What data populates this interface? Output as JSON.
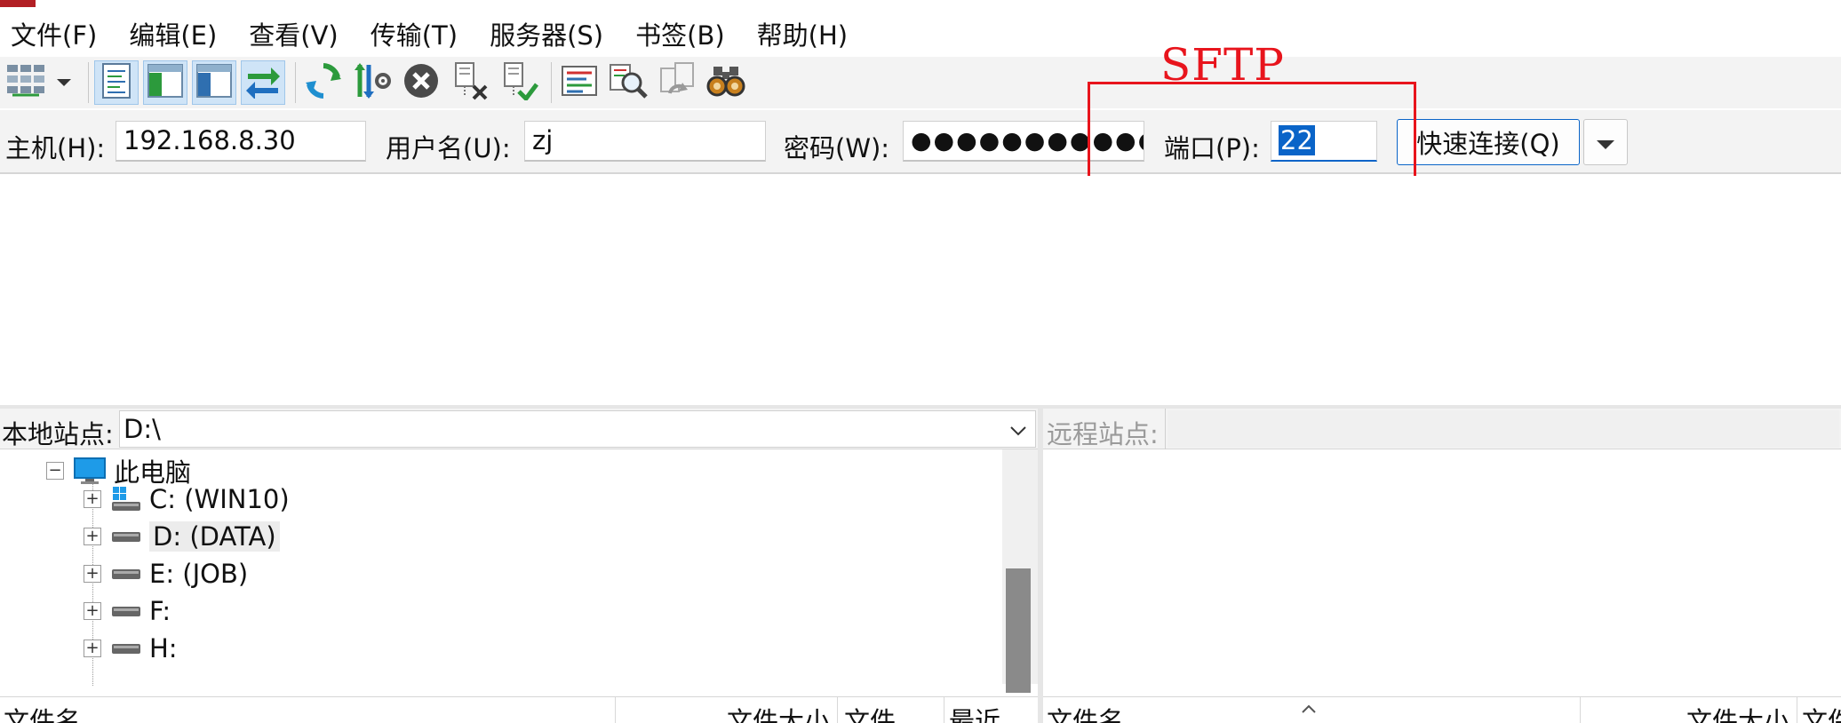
{
  "menu": {
    "items": [
      "文件(F)",
      "编辑(E)",
      "查看(V)",
      "传输(T)",
      "服务器(S)",
      "书签(B)",
      "帮助(H)"
    ]
  },
  "toolbar": {
    "icons": [
      "site-manager-icon",
      "dropdown-arrow-icon",
      "message-log-toggle-icon",
      "local-tree-toggle-icon",
      "remote-tree-toggle-icon",
      "transfer-queue-toggle-icon",
      "refresh-icon",
      "process-queue-icon",
      "cancel-icon",
      "disconnect-icon",
      "reconnect-icon",
      "directory-filter-icon",
      "directory-compare-icon",
      "sync-browse-icon",
      "search-files-icon"
    ]
  },
  "quickconnect": {
    "host_label": "主机(H):",
    "host_value": "192.168.8.30",
    "user_label": "用户名(U):",
    "user_value": "zj",
    "pass_label": "密码(W):",
    "pass_value": "●●●●●●●●●●●",
    "port_label": "端口(P):",
    "port_value": "22",
    "connect_label": "快速连接(Q)"
  },
  "annotation": {
    "text": "SFTP",
    "color": "#e8141c"
  },
  "local": {
    "site_label": "本地站点:",
    "site_path": "D:\\",
    "tree": [
      {
        "label": "此电脑",
        "expander": "−"
      },
      {
        "label": "C: (WIN10)",
        "expander": "+"
      },
      {
        "label": "D: (DATA)",
        "expander": "+"
      },
      {
        "label": "E: (JOB)",
        "expander": "+"
      },
      {
        "label": "F:",
        "expander": "+"
      },
      {
        "label": "H:",
        "expander": "+"
      }
    ],
    "columns": [
      "文件名",
      "文件大小",
      "文件",
      "最近"
    ]
  },
  "remote": {
    "site_label": "远程站点:",
    "columns": [
      "文件名",
      "文件大小",
      "文件"
    ]
  },
  "colors": {
    "accent": "#0a64c8",
    "toolbar_bg": "#f3f3f3",
    "annotation": "#e8141c"
  }
}
